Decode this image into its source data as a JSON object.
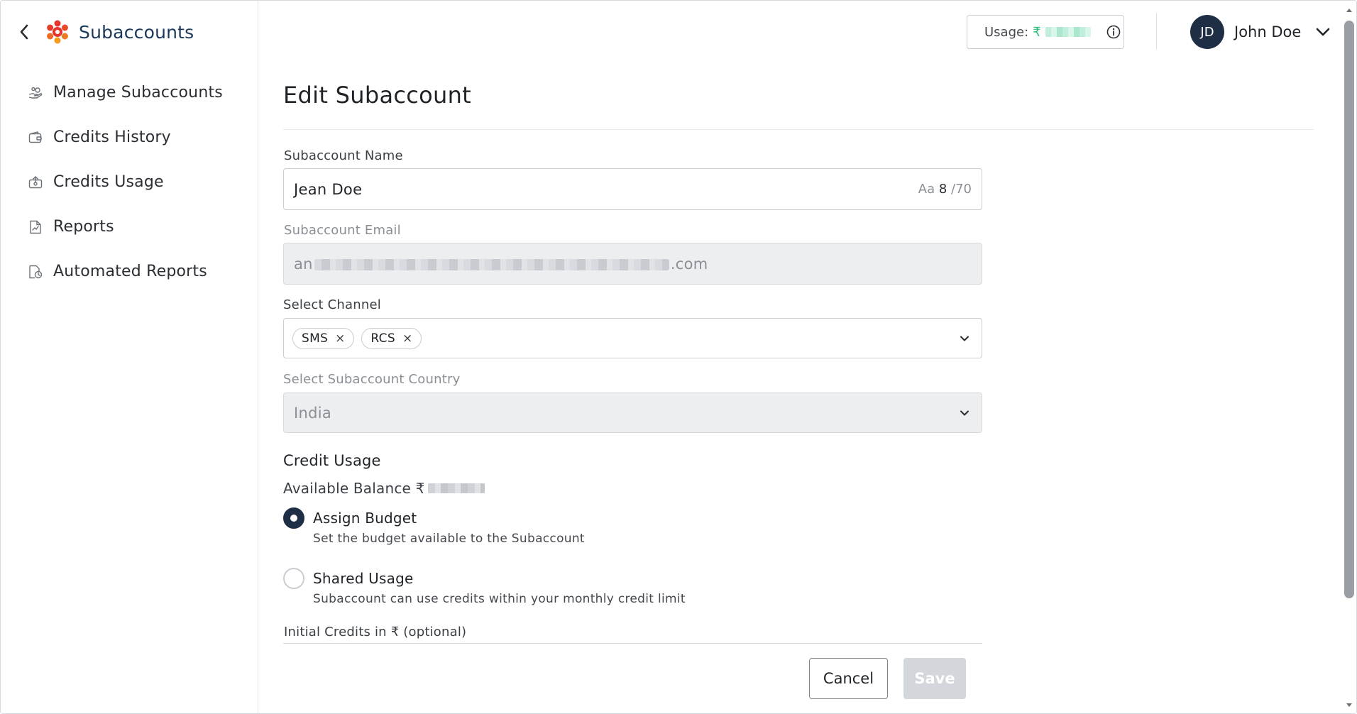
{
  "sidebar": {
    "title": "Subaccounts",
    "items": [
      {
        "label": "Manage Subaccounts",
        "icon": "hand-coins-icon"
      },
      {
        "label": "Credits History",
        "icon": "wallet-icon"
      },
      {
        "label": "Credits Usage",
        "icon": "credit-usage-icon"
      },
      {
        "label": "Reports",
        "icon": "report-icon"
      },
      {
        "label": "Automated Reports",
        "icon": "automated-report-icon"
      }
    ]
  },
  "header": {
    "usage_label": "Usage:",
    "usage_currency": "₹",
    "user_initials": "JD",
    "user_name": "John Doe"
  },
  "page": {
    "title": "Edit Subaccount"
  },
  "form": {
    "name_label": "Subaccount Name",
    "name_value": "Jean Doe",
    "name_count_prefix": "Aa",
    "name_count": "8",
    "name_max": "/70",
    "email_label": "Subaccount Email",
    "email_prefix": "an",
    "email_suffix": ".com",
    "channel_label": "Select Channel",
    "channels": [
      "SMS",
      "RCS"
    ],
    "chip_remove": "×",
    "country_label": "Select Subaccount Country",
    "country_value": "India",
    "credit_section": "Credit Usage",
    "balance_label": "Available Balance ₹",
    "options": [
      {
        "title": "Assign Budget",
        "desc": "Set the budget available to the Subaccount",
        "selected": true
      },
      {
        "title": "Shared Usage",
        "desc": "Subaccount can use credits within your monthly credit limit",
        "selected": false
      }
    ],
    "initial_credits_label": "Initial Credits in ₹ (optional)"
  },
  "actions": {
    "cancel": "Cancel",
    "save": "Save"
  },
  "colors": {
    "brand_dark": "#1e2f45",
    "logo_red": "#e5352c",
    "logo_orange": "#f59a1b",
    "usage_green": "#2fbf7a"
  }
}
